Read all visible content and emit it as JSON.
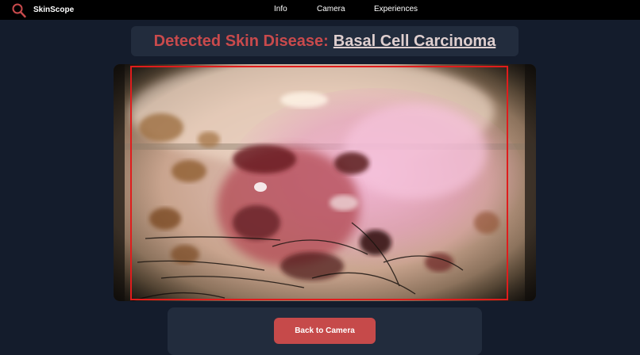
{
  "app": {
    "brand_name": "SkinScope"
  },
  "nav": {
    "links": [
      {
        "label": "Info"
      },
      {
        "label": "Camera"
      },
      {
        "label": "Experiences"
      }
    ]
  },
  "result": {
    "prefix": "Detected Skin Disease:",
    "disease": "Basal Cell Carcinoma"
  },
  "actions": {
    "back_label": "Back to Camera"
  },
  "colors": {
    "background": "#141c2c",
    "navbar": "#000000",
    "card": "#222c3d",
    "accent_red": "#c94a4c",
    "detection_box": "#e01c1c"
  },
  "icons": {
    "brand": "magnifier-icon"
  }
}
